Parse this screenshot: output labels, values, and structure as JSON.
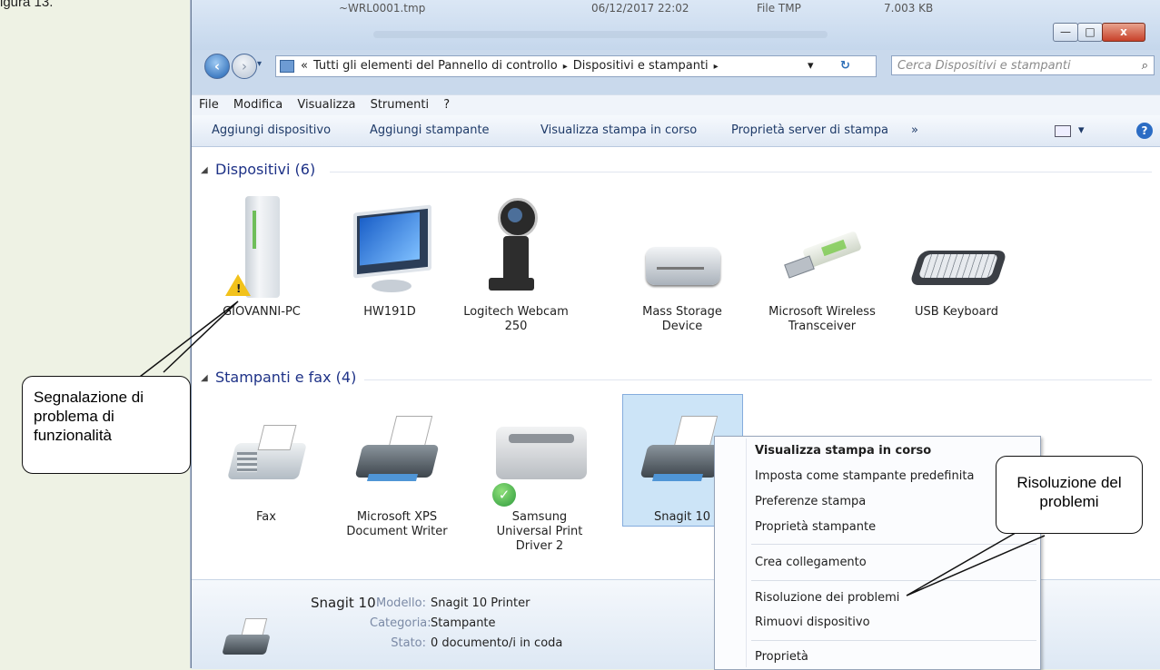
{
  "figure_label": "igura 13.",
  "window": {
    "bg_filename": "~WRL0001.tmp",
    "bg_date": "06/12/2017 22:02",
    "bg_type": "File TMP",
    "bg_size": "7.003 KB",
    "minimize": "—",
    "maximize": "□",
    "close": "x"
  },
  "address": {
    "back": "‹",
    "forward": "›",
    "chevrons": "«",
    "crumb1": "Tutti gli elementi del Pannello di controllo",
    "sep": "▸",
    "crumb2": "Dispositivi e stampanti",
    "dropdown": "▾",
    "refresh": "↻",
    "search_placeholder": "Cerca Dispositivi e stampanti",
    "search_icon": "⌕"
  },
  "menubar": [
    "File",
    "Modifica",
    "Visualizza",
    "Strumenti",
    "?"
  ],
  "toolbar": {
    "add_device": "Aggiungi dispositivo",
    "add_printer": "Aggiungi stampante",
    "see_printing": "Visualizza stampa in corso",
    "server_props": "Proprietà server di stampa",
    "more": "»",
    "views_caret": "▾",
    "help": "?"
  },
  "groups": {
    "devices": "Dispositivi (6)",
    "printers": "Stampanti e fax (4)",
    "toggle": "◢"
  },
  "devices": [
    {
      "name": "GIOVANNI-PC",
      "icon": "pc-tower-icon"
    },
    {
      "name": "HW191D",
      "icon": "monitor-icon"
    },
    {
      "name": "Logitech Webcam 250",
      "icon": "webcam-icon"
    },
    {
      "name": "Mass Storage Device",
      "icon": "hard-drive-icon"
    },
    {
      "name": "Microsoft Wireless Transceiver",
      "icon": "usb-dongle-icon"
    },
    {
      "name": "USB Keyboard",
      "icon": "keyboard-icon"
    }
  ],
  "printers": [
    {
      "name": "Fax",
      "icon": "fax-icon"
    },
    {
      "name": "Microsoft XPS Document Writer",
      "icon": "printer-icon"
    },
    {
      "name": "Samsung Universal Print Driver 2",
      "icon": "laser-printer-icon"
    },
    {
      "name": "Snagit 10",
      "icon": "printer-icon"
    }
  ],
  "details": {
    "name": "Snagit 10",
    "model_label": "Modello:",
    "model_value": "Snagit 10 Printer",
    "category_label": "Categoria:",
    "category_value": "Stampante",
    "status_label": "Stato:",
    "status_value": "0 documento/i in coda"
  },
  "context_menu": {
    "items": [
      "Visualizza stampa in corso",
      "Imposta come stampante predefinita",
      "Preferenze stampa",
      "Proprietà stampante",
      "Crea collegamento",
      "Risoluzione dei problemi",
      "Rimuovi dispositivo",
      "Proprietà"
    ]
  },
  "callouts": {
    "left": "Segnalazione di problema di funzionalità",
    "right": "Risoluzione del problemi"
  },
  "colors": {
    "accent": "#1e3287",
    "selection": "#cce4f7",
    "warning": "#f2c21b",
    "ok": "#3fae49"
  }
}
